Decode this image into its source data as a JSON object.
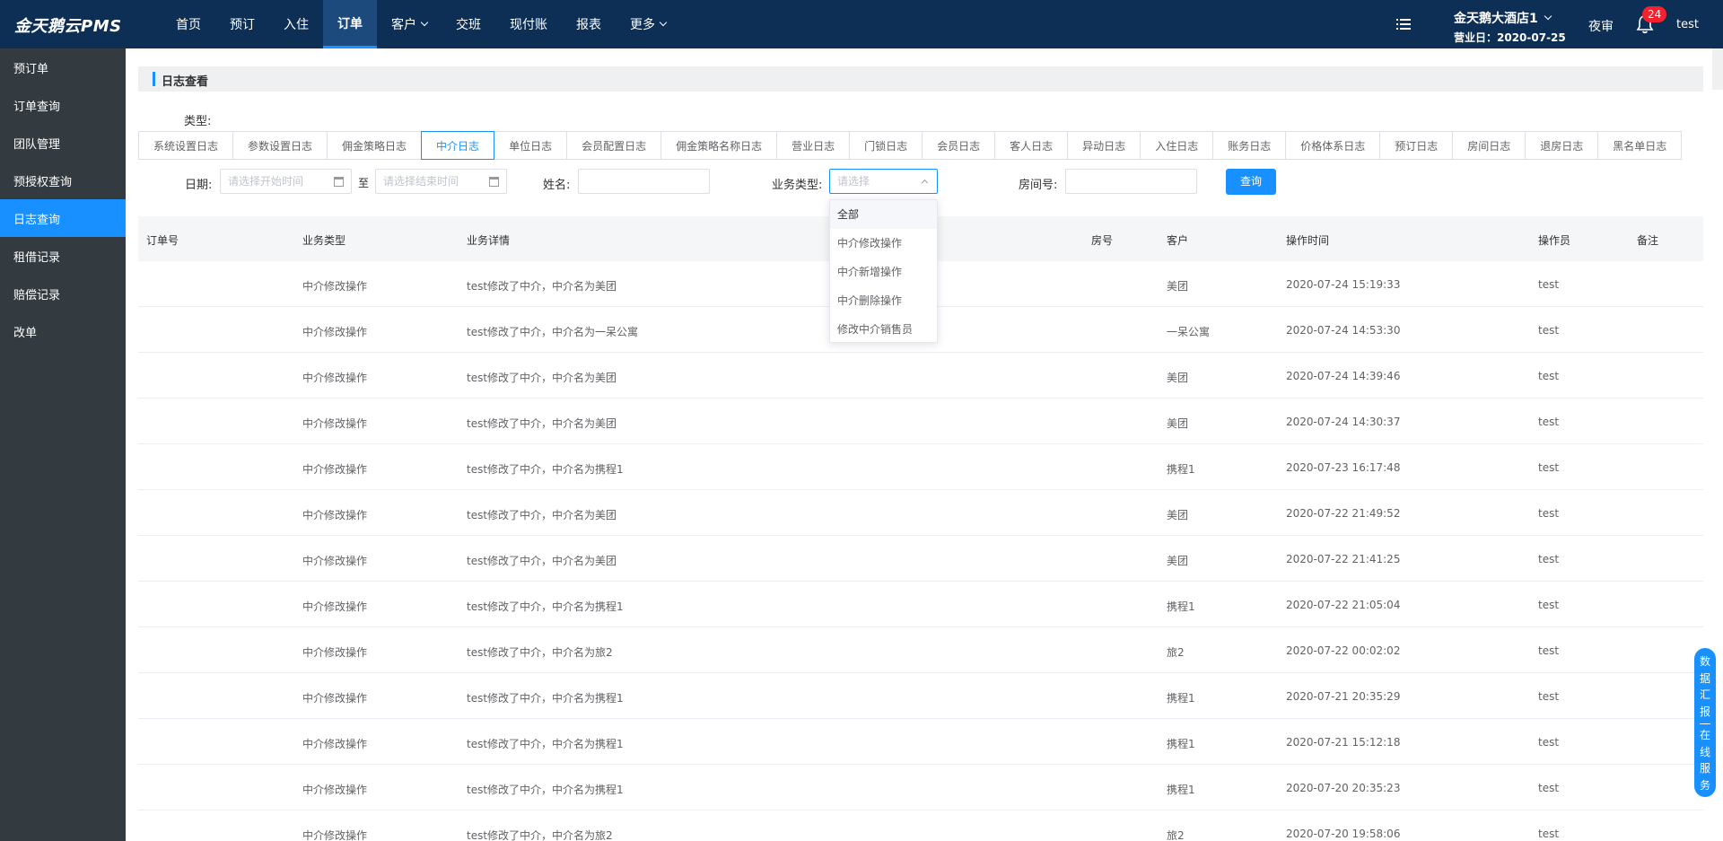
{
  "app": {
    "logo": "金天鹅云PMS",
    "nav": [
      {
        "label": "首页",
        "dropdown": false,
        "active": false
      },
      {
        "label": "预订",
        "dropdown": false,
        "active": false
      },
      {
        "label": "入住",
        "dropdown": false,
        "active": false
      },
      {
        "label": "订单",
        "dropdown": false,
        "active": true
      },
      {
        "label": "客户",
        "dropdown": true,
        "active": false
      },
      {
        "label": "交班",
        "dropdown": false,
        "active": false
      },
      {
        "label": "现付账",
        "dropdown": false,
        "active": false
      },
      {
        "label": "报表",
        "dropdown": false,
        "active": false
      },
      {
        "label": "更多",
        "dropdown": true,
        "active": false
      }
    ],
    "hotel_name": "金天鹅大酒店1",
    "business_day": "营业日：2020-07-25",
    "night_audit": "夜审",
    "notification_count": "24",
    "user": "test"
  },
  "sidebar": {
    "items": [
      {
        "label": "预订单",
        "active": false
      },
      {
        "label": "订单查询",
        "active": false
      },
      {
        "label": "团队管理",
        "active": false
      },
      {
        "label": "预授权查询",
        "active": false
      },
      {
        "label": "日志查询",
        "active": true
      },
      {
        "label": "租借记录",
        "active": false
      },
      {
        "label": "赔偿记录",
        "active": false
      },
      {
        "label": "改单",
        "active": false
      }
    ]
  },
  "page": {
    "title": "日志查看",
    "type_label": "类型:",
    "type_tabs": [
      {
        "label": "系统设置日志",
        "active": false
      },
      {
        "label": "参数设置日志",
        "active": false
      },
      {
        "label": "佣金策略日志",
        "active": false
      },
      {
        "label": "中介日志",
        "active": true
      },
      {
        "label": "单位日志",
        "active": false
      },
      {
        "label": "会员配置日志",
        "active": false
      },
      {
        "label": "佣金策略名称日志",
        "active": false
      },
      {
        "label": "营业日志",
        "active": false
      },
      {
        "label": "门锁日志",
        "active": false
      },
      {
        "label": "会员日志",
        "active": false
      },
      {
        "label": "客人日志",
        "active": false
      },
      {
        "label": "异动日志",
        "active": false
      },
      {
        "label": "入住日志",
        "active": false
      },
      {
        "label": "账务日志",
        "active": false
      },
      {
        "label": "价格体系日志",
        "active": false
      },
      {
        "label": "预订日志",
        "active": false
      },
      {
        "label": "房间日志",
        "active": false
      },
      {
        "label": "退房日志",
        "active": false
      },
      {
        "label": "黑名单日志",
        "active": false
      }
    ],
    "filters": {
      "date_label": "日期:",
      "start_placeholder": "请选择开始时间",
      "to": "至",
      "end_placeholder": "请选择结束时间",
      "name_label": "姓名:",
      "name_value": "",
      "biz_type_label": "业务类型:",
      "biz_type_placeholder": "请选择",
      "room_label": "房间号:",
      "room_value": "",
      "query_button": "查询"
    },
    "biz_type_options": [
      "全部",
      "中介修改操作",
      "中介新增操作",
      "中介删除操作",
      "修改中介销售员"
    ],
    "table": {
      "headers": {
        "order_no": "订单号",
        "biz_type": "业务类型",
        "detail": "业务详情",
        "room": "房号",
        "customer": "客户",
        "time": "操作时间",
        "operator": "操作员",
        "remark": "备注"
      },
      "rows": [
        {
          "order_no": "",
          "biz_type": "中介修改操作",
          "detail": "test修改了中介，中介名为美团",
          "room": "",
          "customer": "美团",
          "time": "2020-07-24 15:19:33",
          "operator": "test",
          "remark": ""
        },
        {
          "order_no": "",
          "biz_type": "中介修改操作",
          "detail": "test修改了中介，中介名为一呆公寓",
          "room": "",
          "customer": "一呆公寓",
          "time": "2020-07-24 14:53:30",
          "operator": "test",
          "remark": ""
        },
        {
          "order_no": "",
          "biz_type": "中介修改操作",
          "detail": "test修改了中介，中介名为美团",
          "room": "",
          "customer": "美团",
          "time": "2020-07-24 14:39:46",
          "operator": "test",
          "remark": ""
        },
        {
          "order_no": "",
          "biz_type": "中介修改操作",
          "detail": "test修改了中介，中介名为美团",
          "room": "",
          "customer": "美团",
          "time": "2020-07-24 14:30:37",
          "operator": "test",
          "remark": ""
        },
        {
          "order_no": "",
          "biz_type": "中介修改操作",
          "detail": "test修改了中介，中介名为携程1",
          "room": "",
          "customer": "携程1",
          "time": "2020-07-23 16:17:48",
          "operator": "test",
          "remark": ""
        },
        {
          "order_no": "",
          "biz_type": "中介修改操作",
          "detail": "test修改了中介，中介名为美团",
          "room": "",
          "customer": "美团",
          "time": "2020-07-22 21:49:52",
          "operator": "test",
          "remark": ""
        },
        {
          "order_no": "",
          "biz_type": "中介修改操作",
          "detail": "test修改了中介，中介名为美团",
          "room": "",
          "customer": "美团",
          "time": "2020-07-22 21:41:25",
          "operator": "test",
          "remark": ""
        },
        {
          "order_no": "",
          "biz_type": "中介修改操作",
          "detail": "test修改了中介，中介名为携程1",
          "room": "",
          "customer": "携程1",
          "time": "2020-07-22 21:05:04",
          "operator": "test",
          "remark": ""
        },
        {
          "order_no": "",
          "biz_type": "中介修改操作",
          "detail": "test修改了中介，中介名为旅2",
          "room": "",
          "customer": "旅2",
          "time": "2020-07-22 00:02:02",
          "operator": "test",
          "remark": ""
        },
        {
          "order_no": "",
          "biz_type": "中介修改操作",
          "detail": "test修改了中介，中介名为携程1",
          "room": "",
          "customer": "携程1",
          "time": "2020-07-21 20:35:29",
          "operator": "test",
          "remark": ""
        },
        {
          "order_no": "",
          "biz_type": "中介修改操作",
          "detail": "test修改了中介，中介名为携程1",
          "room": "",
          "customer": "携程1",
          "time": "2020-07-21 15:12:18",
          "operator": "test",
          "remark": ""
        },
        {
          "order_no": "",
          "biz_type": "中介修改操作",
          "detail": "test修改了中介，中介名为携程1",
          "room": "",
          "customer": "携程1",
          "time": "2020-07-20 20:35:23",
          "operator": "test",
          "remark": ""
        },
        {
          "order_no": "",
          "biz_type": "中介修改操作",
          "detail": "test修改了中介，中介名为旅2",
          "room": "",
          "customer": "旅2",
          "time": "2020-07-20 19:58:06",
          "operator": "test",
          "remark": ""
        }
      ]
    },
    "float_tab": "数据汇报｜在线服务",
    "colors": {
      "nav_bg": "#0d2f55",
      "accent": "#1890ff",
      "sidebar_bg": "#333a40",
      "badge": "#f5222d"
    }
  }
}
